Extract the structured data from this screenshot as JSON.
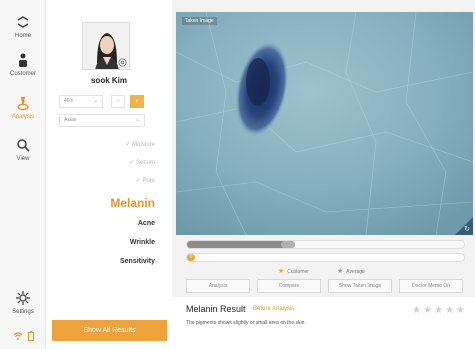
{
  "nav": {
    "items": [
      {
        "label": "Home",
        "icon": "home-icon"
      },
      {
        "label": "Customer",
        "icon": "customer-icon"
      },
      {
        "label": "Analysis",
        "icon": "analysis-icon"
      },
      {
        "label": "View",
        "icon": "search-icon"
      }
    ],
    "settings_label": "Settings",
    "accent_color": "#e8952a"
  },
  "profile": {
    "name": "sook Kim",
    "age_select": "40's",
    "region_select": "Asian",
    "gender_male_icon": "male-icon",
    "gender_female_icon": "female-icon"
  },
  "categories": {
    "done": [
      "Moisture",
      "Sebum",
      "Pore"
    ],
    "current": "Melanin",
    "upcoming": [
      "Acne",
      "Wrinkle",
      "Sensitivity"
    ]
  },
  "show_all_label": "Show All Results",
  "image": {
    "label": "Taken Image"
  },
  "sliders": {
    "customer_level": 0.39,
    "average_level_label": "0"
  },
  "legend": {
    "customer": "Customer",
    "average": "Average"
  },
  "tabs": [
    "Analysis",
    "Compare",
    "Show Taken Image",
    "Doctor Memo On"
  ],
  "result": {
    "title": "Melanin Result",
    "subtitle": "Before Analysis",
    "text": "The pigments shows slightly or small area on the skin."
  }
}
